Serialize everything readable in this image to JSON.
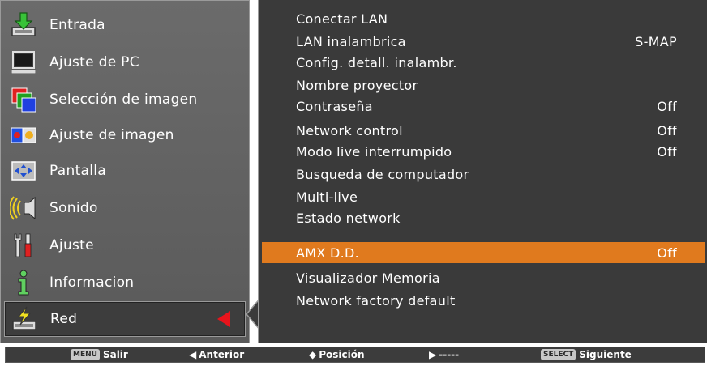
{
  "menu": {
    "items": [
      {
        "label": "Entrada",
        "icon": "input-arrow-icon"
      },
      {
        "label": "Ajuste de PC",
        "icon": "computer-monitor-icon"
      },
      {
        "label": "Selección de imagen",
        "icon": "image-select-icon"
      },
      {
        "label": "Ajuste de imagen",
        "icon": "image-adjust-icon"
      },
      {
        "label": "Pantalla",
        "icon": "screen-arrows-icon"
      },
      {
        "label": "Sonido",
        "icon": "speaker-icon"
      },
      {
        "label": "Ajuste",
        "icon": "tools-icon"
      },
      {
        "label": "Informacion",
        "icon": "info-icon"
      },
      {
        "label": "Red",
        "icon": "network-icon"
      }
    ],
    "selected_index": 8
  },
  "submenu": {
    "items": [
      {
        "label": "Conectar LAN",
        "value": ""
      },
      {
        "label": "LAN inalambrica",
        "value": "S-MAP"
      },
      {
        "label": "Config. detall. inalambr.",
        "value": ""
      },
      {
        "label": "Nombre proyector",
        "value": ""
      },
      {
        "label": "Contraseña",
        "value": "Off"
      },
      {
        "label": "Network control",
        "value": "Off"
      },
      {
        "label": "Modo live interrumpido",
        "value": "Off"
      },
      {
        "label": "Busqueda de computador",
        "value": ""
      },
      {
        "label": "Multi-live",
        "value": ""
      },
      {
        "label": "Estado network",
        "value": ""
      },
      {
        "label": "AMX D.D.",
        "value": "Off"
      },
      {
        "label": "Visualizador Memoria",
        "value": ""
      },
      {
        "label": "Network factory default",
        "value": ""
      }
    ],
    "selected_index": 10
  },
  "footer": {
    "menu_key": "MENU",
    "exit_label": "Salir",
    "previous_label": "Anterior",
    "position_label": "Posición",
    "next_dashes": "-----",
    "select_key": "SELECT",
    "next_label": "Siguiente"
  },
  "colors": {
    "highlight": "#e07a1e",
    "arrow": "#e8141c",
    "panel_left": "#5f5f5f",
    "panel_right": "#3a3a3a"
  }
}
